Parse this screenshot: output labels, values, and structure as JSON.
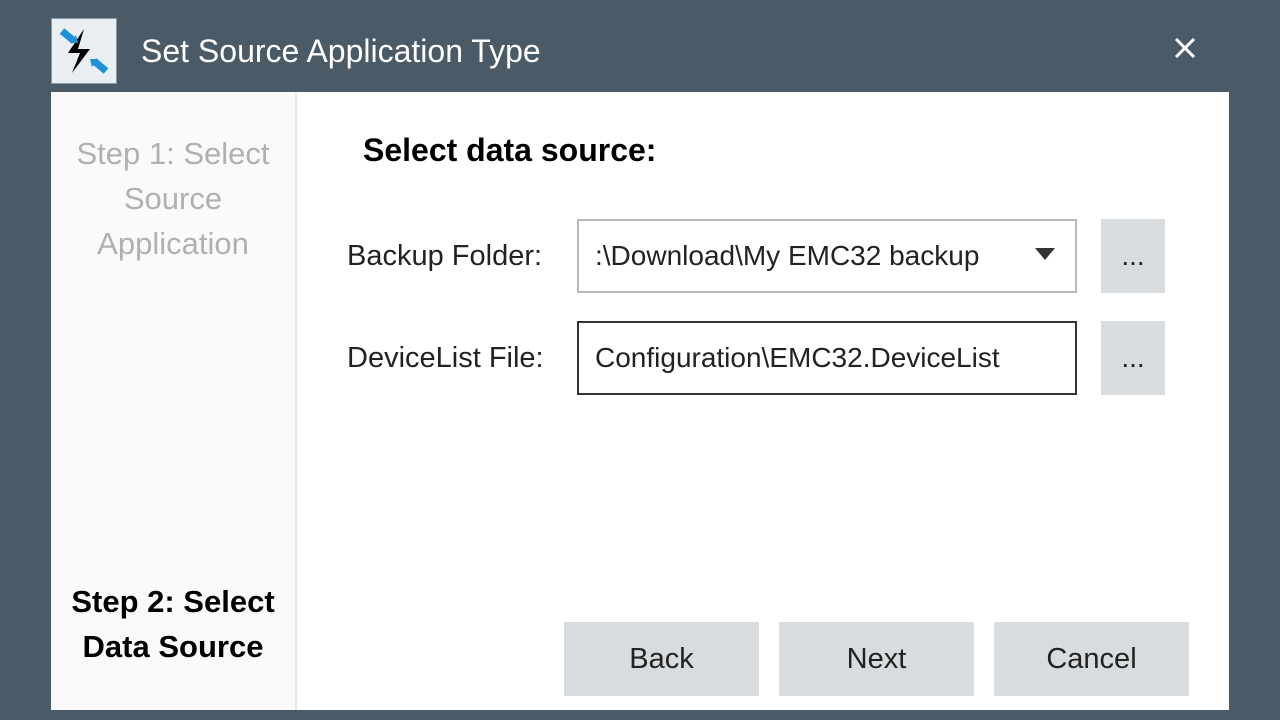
{
  "title": "Set Source Application Type",
  "sidebar": {
    "steps": [
      {
        "label": "Step 1: Select Source Application",
        "active": false
      },
      {
        "label": "Step 2: Select Data Source",
        "active": true
      }
    ]
  },
  "main": {
    "heading": "Select data source:",
    "fields": {
      "backup_folder": {
        "label": "Backup Folder:",
        "value": ":\\Download\\My EMC32 backup",
        "browse": "..."
      },
      "devicelist_file": {
        "label": "DeviceList File:",
        "value": "Configuration\\EMC32.DeviceList",
        "browse": "..."
      }
    }
  },
  "buttons": {
    "back": "Back",
    "next": "Next",
    "cancel": "Cancel"
  }
}
